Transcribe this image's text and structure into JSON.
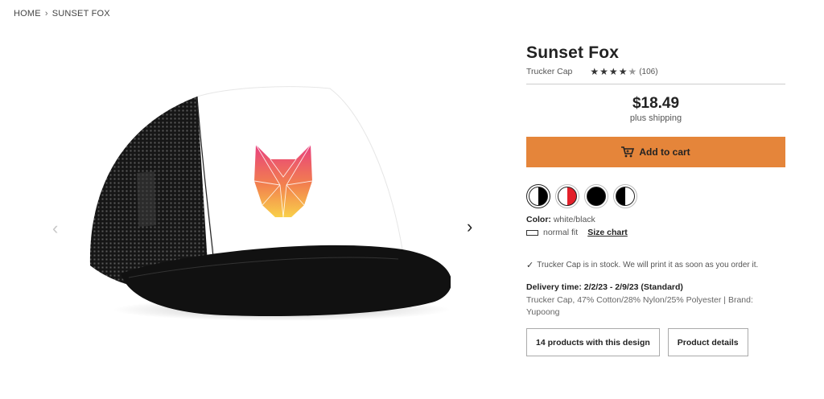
{
  "breadcrumb": {
    "home": "HOME",
    "separator": "›",
    "current": "SUNSET FOX"
  },
  "gallery": {
    "prev_icon": "‹",
    "next_icon": "›"
  },
  "product": {
    "title": "Sunset Fox",
    "type": "Trucker Cap",
    "rating_count": "(106)",
    "rating": 4.5,
    "price": "$18.49",
    "shipping": "plus shipping",
    "add_to_cart": "Add to cart",
    "color_label": "Color:",
    "color_value": "white/black",
    "fit": "normal fit",
    "size_chart": "Size chart",
    "stock": "Trucker Cap is in stock. We will print it as soon as you order it.",
    "delivery": "Delivery time: 2/2/23 - 2/9/23 (Standard)",
    "description": "Trucker Cap, 47% Cotton/28% Nylon/25% Polyester | Brand: Yupoong",
    "products_with_design": "14 products with this design",
    "product_details": "Product details"
  },
  "swatches": [
    {
      "name": "white/black",
      "left": "#ffffff",
      "right": "#000000",
      "selected": true
    },
    {
      "name": "white/red",
      "left": "#ffffff",
      "right": "#e3202a",
      "selected": false
    },
    {
      "name": "black",
      "left": "#000000",
      "right": "#000000",
      "selected": false
    },
    {
      "name": "black/white",
      "left": "#000000",
      "right": "#ffffff",
      "selected": false
    }
  ],
  "colors": {
    "accent": "#e5853a",
    "text": "#222222"
  }
}
